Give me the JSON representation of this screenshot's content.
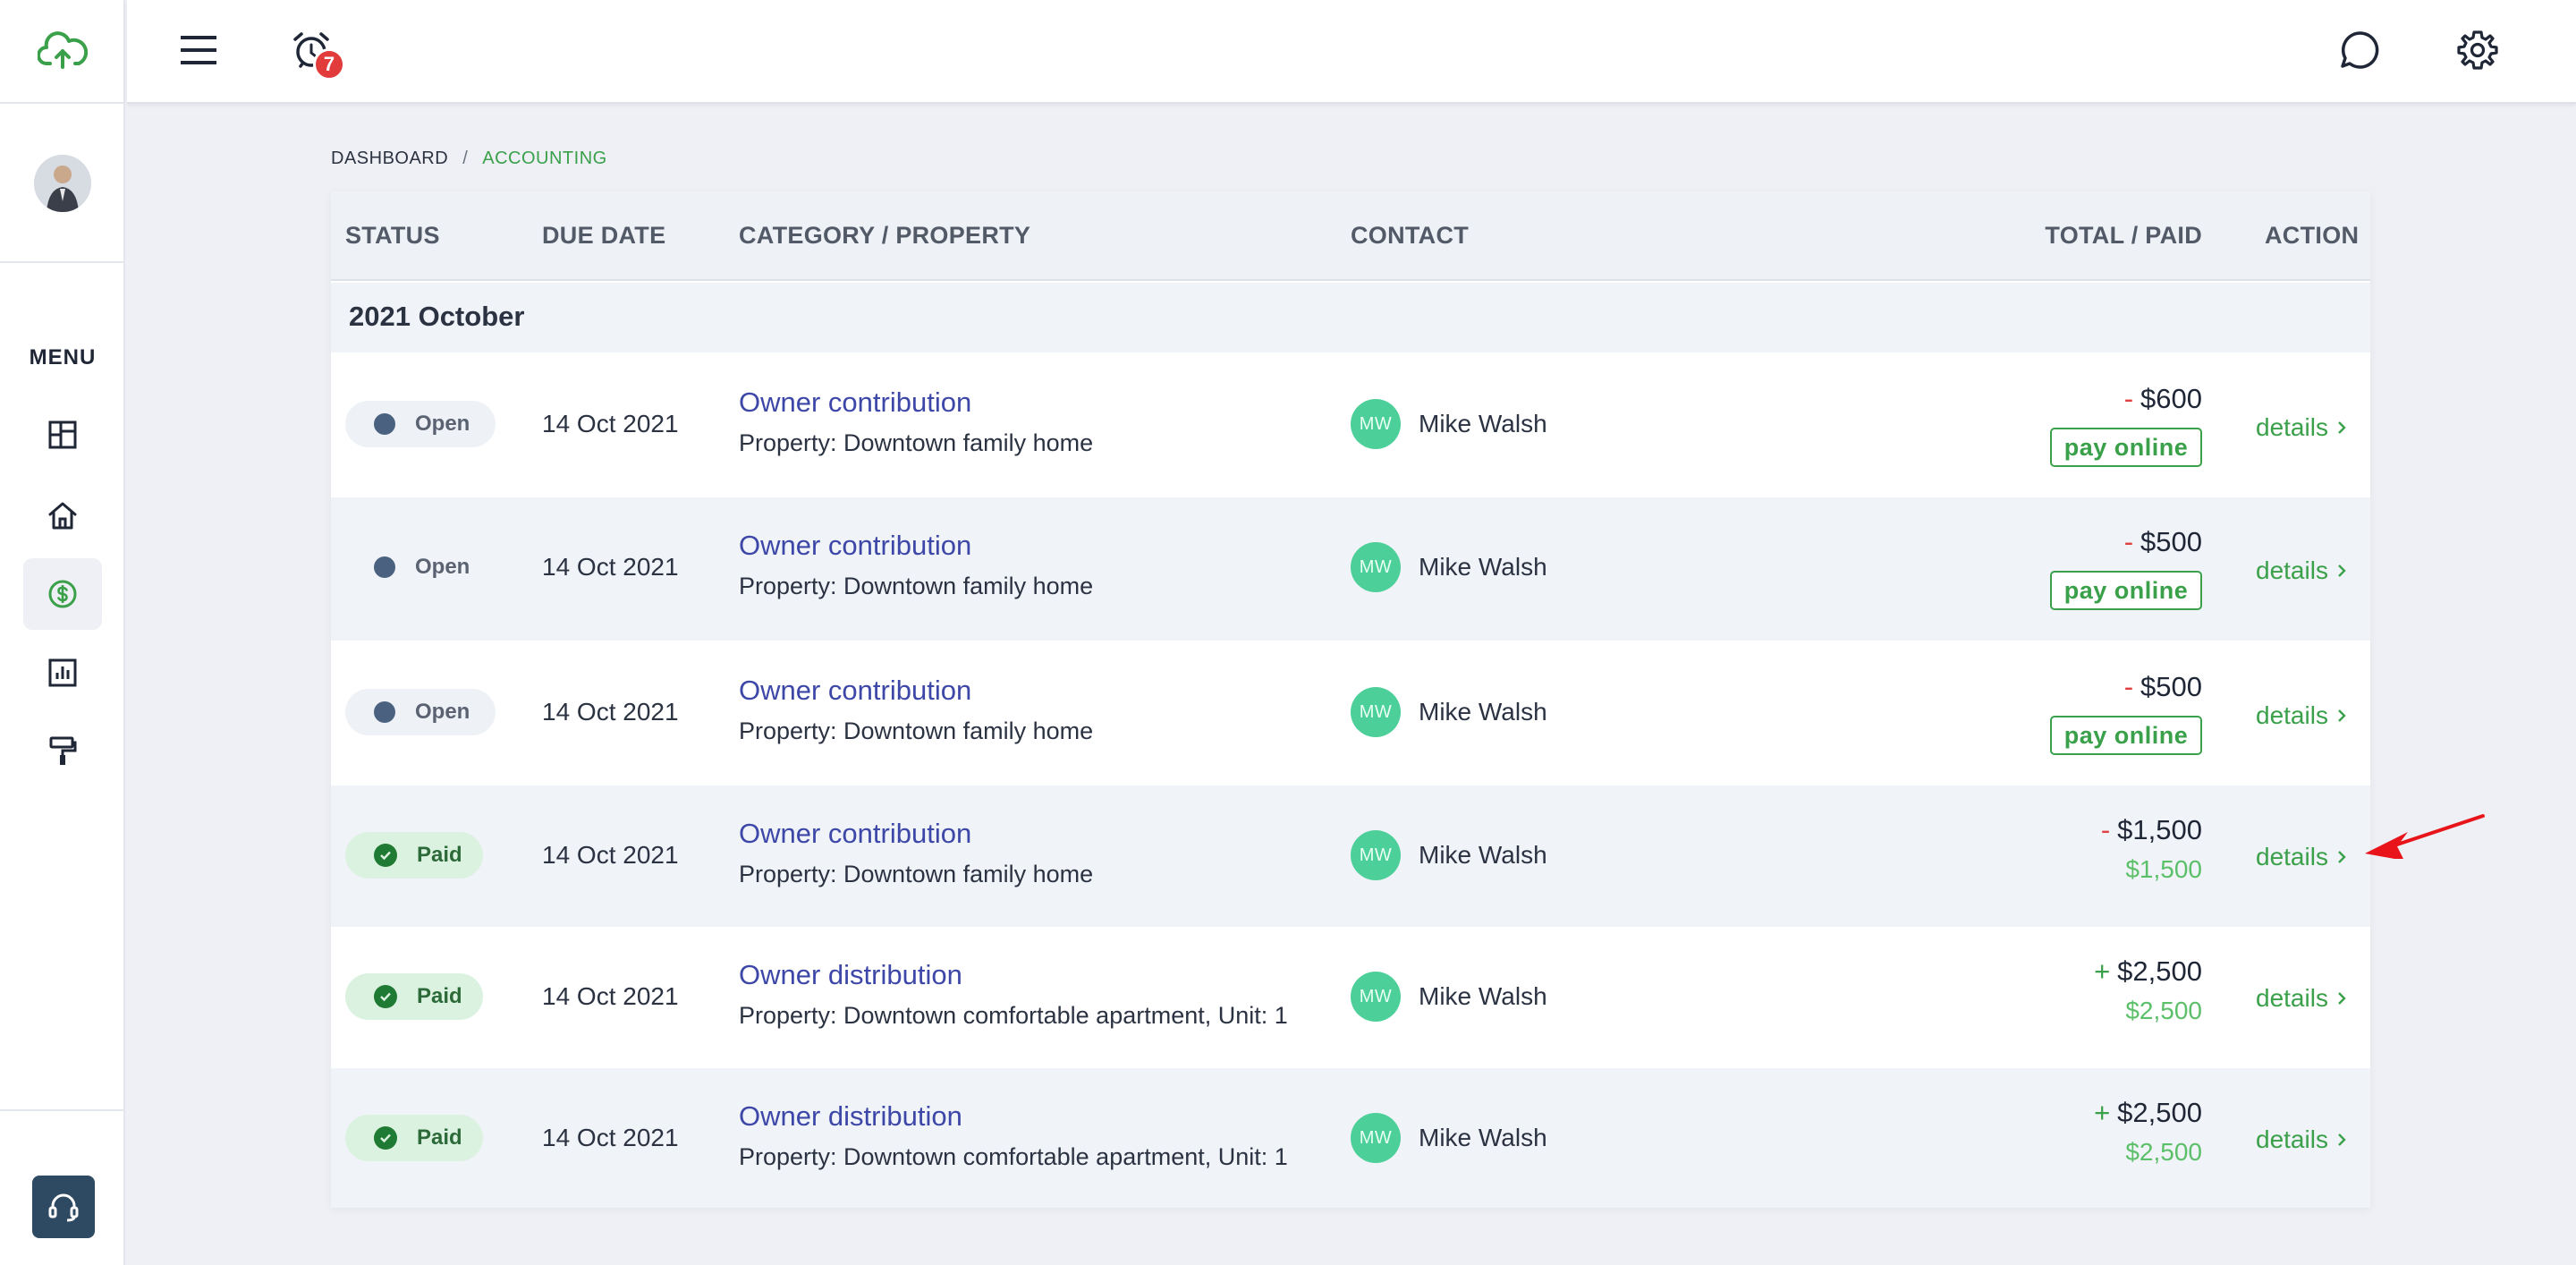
{
  "topbar": {
    "notification_count": "7"
  },
  "breadcrumb": {
    "root": "DASHBOARD",
    "separator": "/",
    "current": "ACCOUNTING"
  },
  "sidebar": {
    "menu_label": "MENU",
    "items": [
      {
        "icon": "dashboard-icon"
      },
      {
        "icon": "home-icon"
      },
      {
        "icon": "dollar-icon",
        "active": true
      },
      {
        "icon": "reports-icon"
      },
      {
        "icon": "maintenance-icon"
      }
    ]
  },
  "table": {
    "headers": {
      "status": "STATUS",
      "due_date": "DUE DATE",
      "category": "CATEGORY / PROPERTY",
      "contact": "CONTACT",
      "total": "TOTAL / PAID",
      "action": "ACTION"
    },
    "group_label": "2021 October",
    "rows": [
      {
        "status": "Open",
        "due": "14 Oct 2021",
        "category": "Owner contribution",
        "property": "Property: Downtown family home",
        "initials": "MW",
        "contact": "Mike Walsh",
        "sign": "-",
        "total": "$600",
        "pay": "pay online",
        "paid": "",
        "action": "details"
      },
      {
        "status": "Open",
        "due": "14 Oct 2021",
        "category": "Owner contribution",
        "property": "Property: Downtown family home",
        "initials": "MW",
        "contact": "Mike Walsh",
        "sign": "-",
        "total": "$500",
        "pay": "pay online",
        "paid": "",
        "action": "details"
      },
      {
        "status": "Open",
        "due": "14 Oct 2021",
        "category": "Owner contribution",
        "property": "Property: Downtown family home",
        "initials": "MW",
        "contact": "Mike Walsh",
        "sign": "-",
        "total": "$500",
        "pay": "pay online",
        "paid": "",
        "action": "details"
      },
      {
        "status": "Paid",
        "due": "14 Oct 2021",
        "category": "Owner contribution",
        "property": "Property: Downtown family home",
        "initials": "MW",
        "contact": "Mike Walsh",
        "sign": "-",
        "total": "$1,500",
        "pay": "",
        "paid": "$1,500",
        "action": "details"
      },
      {
        "status": "Paid",
        "due": "14 Oct 2021",
        "category": "Owner distribution",
        "property": "Property: Downtown comfortable apartment, Unit: 1",
        "initials": "MW",
        "contact": "Mike Walsh",
        "sign": "+",
        "total": "$2,500",
        "pay": "",
        "paid": "$2,500",
        "action": "details"
      },
      {
        "status": "Paid",
        "due": "14 Oct 2021",
        "category": "Owner distribution",
        "property": "Property: Downtown comfortable apartment, Unit: 1",
        "initials": "MW",
        "contact": "Mike Walsh",
        "sign": "+",
        "total": "$2,500",
        "pay": "",
        "paid": "$2,500",
        "action": "details"
      }
    ]
  },
  "colors": {
    "accent_green": "#3aa04a",
    "link_blue": "#3d47a8",
    "negative_red": "#e04040",
    "badge_red": "#e23b3b",
    "avatar_teal": "#4ccf98"
  }
}
